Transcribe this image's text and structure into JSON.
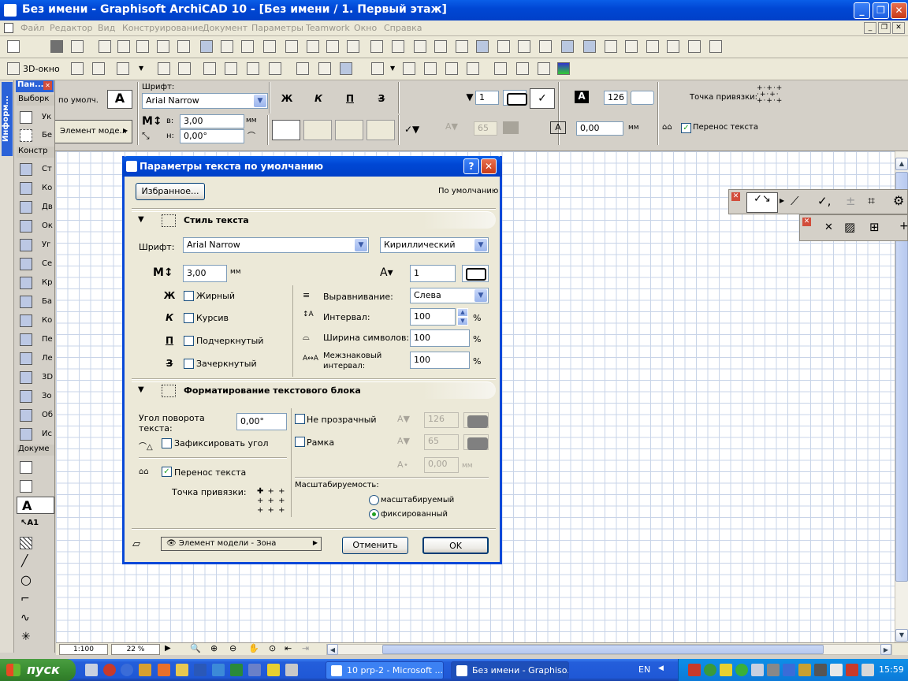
{
  "window": {
    "title": "Без имени - Graphisoft ArchiCAD 10 - [Без имени / 1. Первый этаж]"
  },
  "menu": [
    "Файл",
    "Редактор",
    "Вид",
    "Конструирование",
    "Документ",
    "Параметры",
    "Teamwork",
    "Окно",
    "Справка"
  ],
  "toolbar": {
    "window3d_label": "3D-окно"
  },
  "infobox": {
    "default_label": "по умолч.",
    "font_label": "Шрифт:",
    "font_value": "Arial Narrow",
    "bold_sym": "Ж",
    "italic_sym": "К",
    "underline_sym": "П",
    "strike_sym": "З",
    "pen_value": "1",
    "pen_value2": "126",
    "anchor_label": "Точка привязки:",
    "element_btn": "Элемент моде...",
    "height_prefix": "в:",
    "height_value": "3,00",
    "height_unit": "мм",
    "angle_prefix": "н:",
    "angle_value": "0,00°",
    "disabled_pen": "65",
    "offset_value": "0,00",
    "offset_unit": "мм",
    "wrap_label": "Перенос текста"
  },
  "toolbox": {
    "header": "Пан...",
    "info_vertical": "Информ...",
    "select_section": "Выборк",
    "construct_section": "Констр",
    "document_section": "Докуме",
    "items": [
      "Ук",
      "Бе",
      "Ст",
      "Ко",
      "Дв",
      "Ок",
      "Уг",
      "Се",
      "Кр",
      "Ба",
      "Ко",
      "Пе",
      "Ле",
      "3D",
      "Зо",
      "Об",
      "Ис"
    ]
  },
  "dialog": {
    "title": "Параметры текста по умолчанию",
    "favorites_btn": "Избранное...",
    "default_label": "По умолчанию",
    "section1": "Стиль текста",
    "font_label": "Шрифт:",
    "font_value": "Arial Narrow",
    "charset_value": "Кириллический",
    "size_value": "3,00",
    "size_unit": "мм",
    "pen_value": "1",
    "bold": "Жирный",
    "italic": "Курсив",
    "underline": "Подчеркнутый",
    "strike": "Зачеркнутый",
    "align_label": "Выравнивание:",
    "align_value": "Слева",
    "spacing_label": "Интервал:",
    "spacing_value": "100",
    "width_label": "Ширина символов:",
    "width_value": "100",
    "charspace_label1": "Межзнаковый",
    "charspace_label2": "интервал:",
    "charspace_value": "100",
    "percent": "%",
    "section2": "Форматирование текстового блока",
    "rotation_label1": "Угол поворота",
    "rotation_label2": "текста:",
    "rotation_value": "0,00°",
    "fix_angle": "Зафиксировать угол",
    "wrap": "Перенос текста",
    "anchor_label": "Точка привязки:",
    "opaque": "Не прозрачный",
    "frame": "Рамка",
    "opaque_pen": "126",
    "frame_pen": "65",
    "frame_offset": "0,00",
    "offset_unit": "мм",
    "scale_label": "Масштабируемость:",
    "scalable": "масштабируемый",
    "fixed": "фиксированный",
    "layer_value": "Элемент модели - Зона",
    "cancel_btn": "Отменить",
    "ok_btn": "OK"
  },
  "statusbar": {
    "scale": "1:100",
    "zoom": "22 %"
  },
  "taskbar": {
    "start": "пуск",
    "tasks": [
      "10 prp-2 - Microsoft ...",
      "Без имени - Graphiso..."
    ],
    "lang": "EN",
    "time": "15:59"
  }
}
